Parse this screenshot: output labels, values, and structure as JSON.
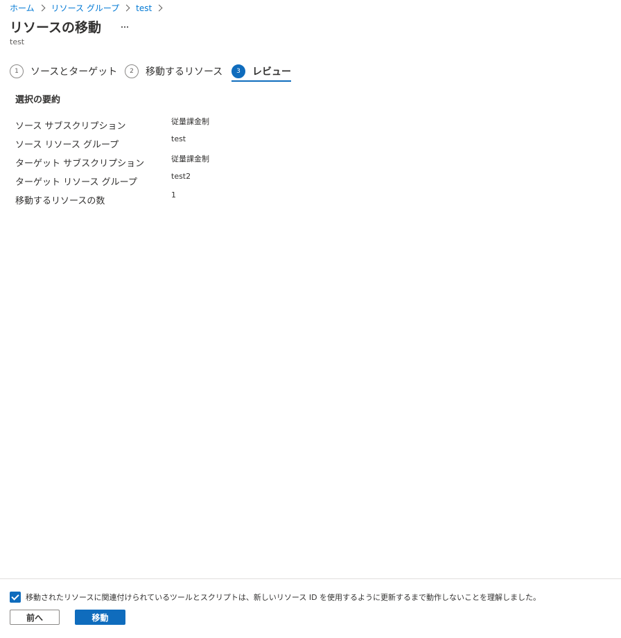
{
  "breadcrumb": [
    "ホーム",
    "リソース グループ",
    "test"
  ],
  "page": {
    "title": "リソースの移動",
    "subtitle": "test",
    "more_label": "..."
  },
  "steps": [
    {
      "number": "1",
      "label": "ソースとターゲット",
      "active": false
    },
    {
      "number": "2",
      "label": "移動するリソース",
      "active": false
    },
    {
      "number": "3",
      "label": "レビュー",
      "active": true
    }
  ],
  "summary": {
    "heading": "選択の要約",
    "rows": [
      {
        "key": "ソース サブスクリプション",
        "value": "従量課金制"
      },
      {
        "key": "ソース リソース グループ",
        "value": "test"
      },
      {
        "key": "ターゲット サブスクリプション",
        "value": "従量課金制"
      },
      {
        "key": "ターゲット リソース グループ",
        "value": "test2"
      },
      {
        "key": "移動するリソースの数",
        "value": "1"
      }
    ]
  },
  "footer": {
    "acknowledgement": "移動されたリソースに関連付けられているツールとスクリプトは、新しいリソース ID を使用するように更新するまで動作しないことを理解しました。",
    "acknowledgement_checked": true,
    "prev_label": "前へ",
    "move_label": "移動"
  },
  "colors": {
    "accent": "#0f6cbd",
    "link": "#0078d4"
  }
}
